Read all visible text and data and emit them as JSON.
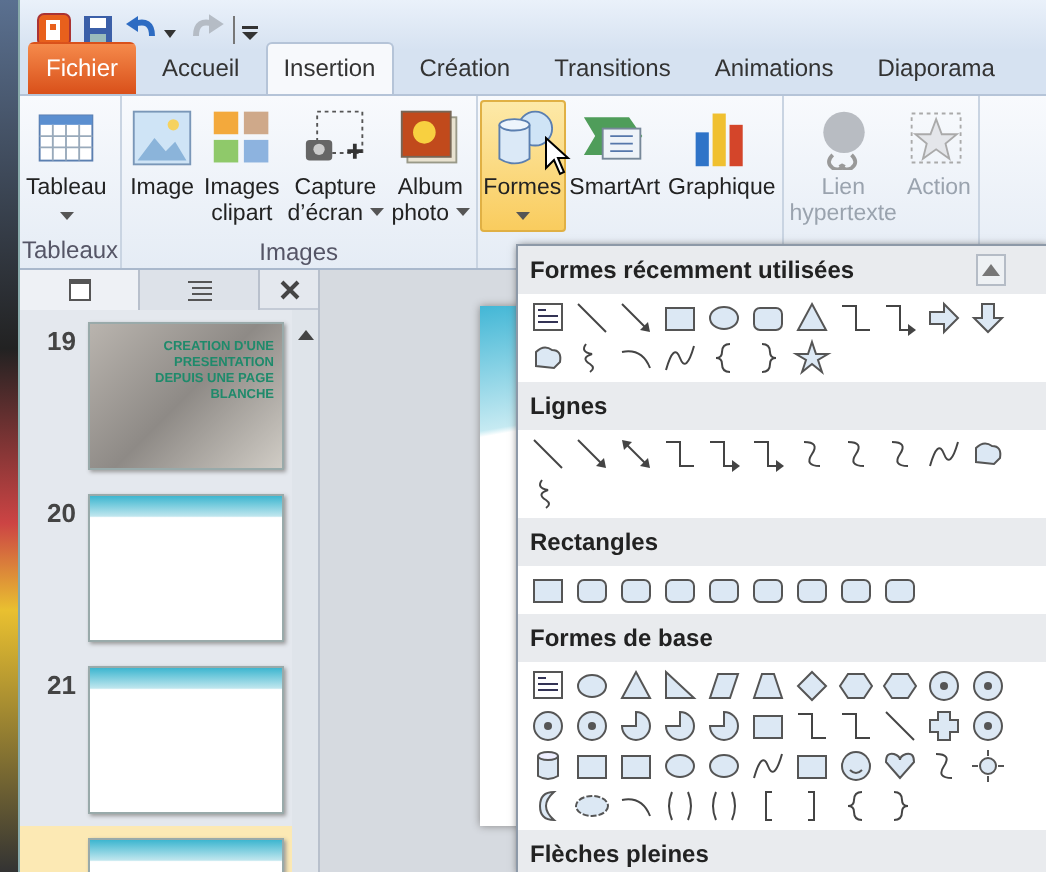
{
  "quick_access": [
    {
      "kind": "app",
      "disabled": false
    },
    {
      "kind": "save",
      "disabled": false
    },
    {
      "kind": "undo",
      "disabled": false
    },
    {
      "kind": "redo",
      "disabled": true
    },
    {
      "kind": "customize",
      "disabled": false
    }
  ],
  "tabs": [
    {
      "label": "Fichier",
      "kind": "file",
      "selected": false
    },
    {
      "label": "Accueil",
      "kind": "tab",
      "selected": false
    },
    {
      "label": "Insertion",
      "kind": "tab",
      "selected": true
    },
    {
      "label": "Création",
      "kind": "tab",
      "selected": false
    },
    {
      "label": "Transitions",
      "kind": "tab",
      "selected": false
    },
    {
      "label": "Animations",
      "kind": "tab",
      "selected": false
    },
    {
      "label": "Diaporama",
      "kind": "tab",
      "selected": false
    }
  ],
  "ribbon_groups": [
    {
      "label": "Tableaux",
      "buttons": [
        {
          "label_lines": [
            "Tableau"
          ],
          "dropdown": true,
          "pressed": false,
          "disabled": false
        }
      ]
    },
    {
      "label": "Images",
      "buttons": [
        {
          "label_lines": [
            "Image"
          ],
          "dropdown": false,
          "pressed": false,
          "disabled": false
        },
        {
          "label_lines": [
            "Images",
            "clipart"
          ],
          "dropdown": false,
          "pressed": false,
          "disabled": false
        },
        {
          "label_lines": [
            "Capture",
            "d’écran"
          ],
          "dropdown": true,
          "pressed": false,
          "disabled": false
        },
        {
          "label_lines": [
            "Album",
            "photo"
          ],
          "dropdown": true,
          "pressed": false,
          "disabled": false
        }
      ]
    },
    {
      "buttons": [
        {
          "label_lines": [
            "Formes"
          ],
          "dropdown": true,
          "pressed": true,
          "disabled": false
        },
        {
          "label_lines": [
            "SmartArt"
          ],
          "dropdown": false,
          "pressed": false,
          "disabled": false
        },
        {
          "label_lines": [
            "Graphique"
          ],
          "dropdown": false,
          "pressed": false,
          "disabled": false
        }
      ]
    },
    {
      "buttons": [
        {
          "label_lines": [
            "Lien",
            "hypertexte"
          ],
          "dropdown": false,
          "pressed": false,
          "disabled": true
        },
        {
          "label_lines": [
            "Action"
          ],
          "dropdown": false,
          "pressed": false,
          "disabled": true
        }
      ]
    }
  ],
  "slides_pane": {
    "tabs": [
      {
        "kind": "slides",
        "selected": true
      },
      {
        "kind": "outline",
        "selected": false
      }
    ],
    "slides": [
      {
        "number": "19",
        "kind": "photo",
        "title": "CREATION D'UNE PRESENTATION DEPUIS UNE PAGE BLANCHE",
        "selected": false
      },
      {
        "number": "20",
        "kind": "screenshot",
        "selected": false
      },
      {
        "number": "21",
        "kind": "screenshot",
        "selected": false
      },
      {
        "kind": "screenshot",
        "selected": true
      }
    ]
  },
  "shapes_gallery": {
    "sections": [
      {
        "title": "Formes récemment utilisées"
      },
      {
        "title": "Lignes"
      },
      {
        "title": "Rectangles"
      },
      {
        "title": "Formes de base"
      },
      {
        "title": "Flèches pleines"
      }
    ]
  }
}
